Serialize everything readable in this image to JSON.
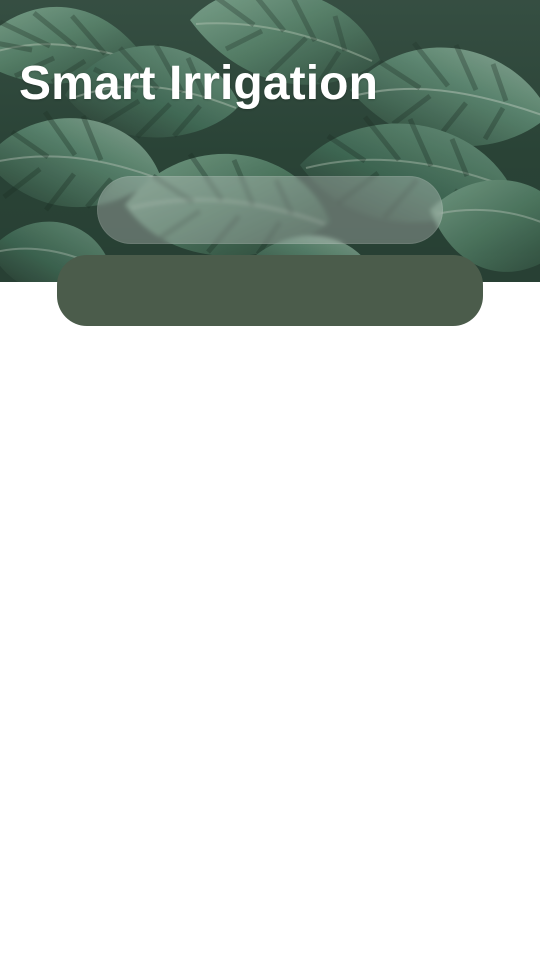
{
  "app": {
    "title": "Smart Irrigation"
  },
  "hero": {
    "background": "tropical-leaves-image"
  },
  "colors": {
    "title_text": "#ffffff",
    "panel": "#4b5c4b",
    "page_background": "#ffffff"
  }
}
